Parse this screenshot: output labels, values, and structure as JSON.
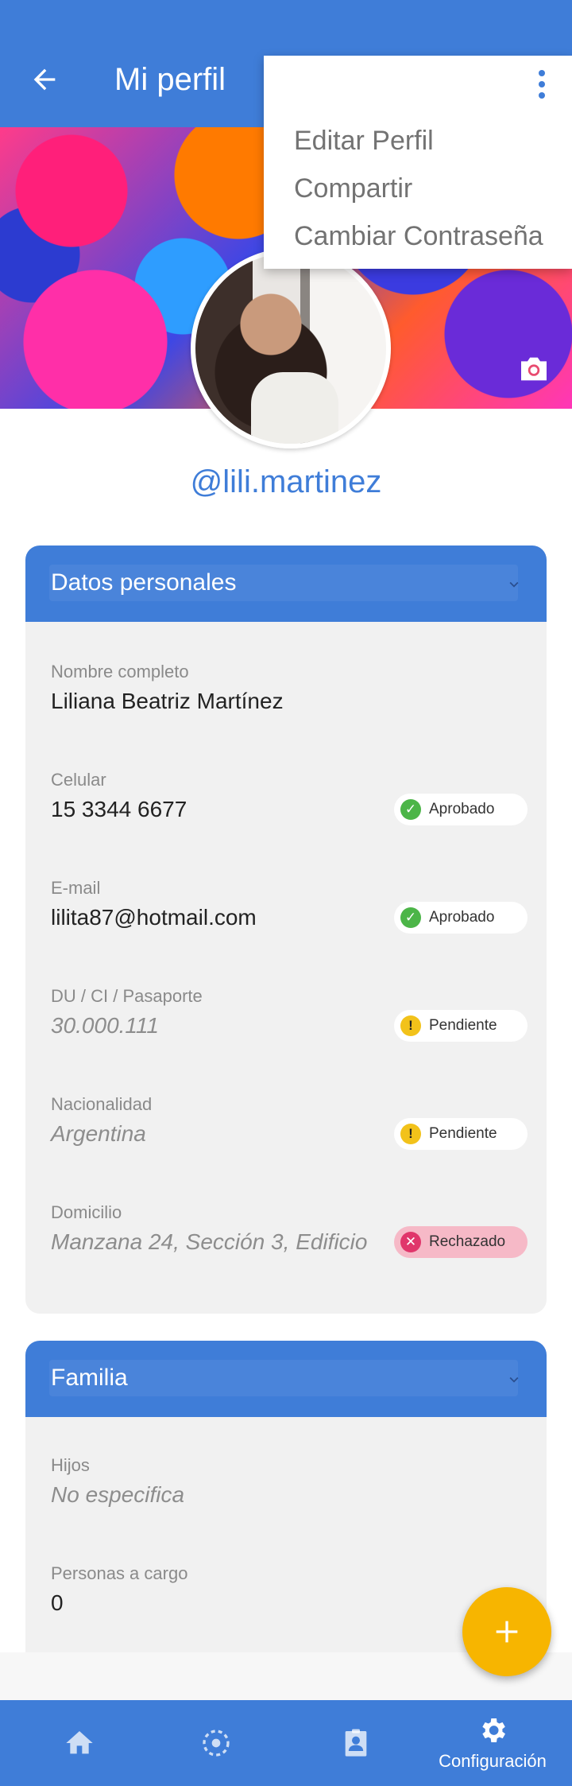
{
  "app_bar": {
    "title": "Mi perfil"
  },
  "menu": {
    "items": [
      "Editar Perfil",
      "Compartir",
      "Cambiar Contraseña"
    ]
  },
  "profile": {
    "username": "@lili.martinez"
  },
  "personal": {
    "title": "Datos personales",
    "fields": [
      {
        "label": "Nombre completo",
        "value": "Liliana Beatriz Martínez"
      },
      {
        "label": "Celular",
        "value": "15 3344 6677",
        "status": "Aprobado"
      },
      {
        "label": "E-mail",
        "value": "lilita87@hotmail.com",
        "status": "Aprobado"
      },
      {
        "label": "DU / CI / Pasaporte",
        "value": "30.000.111",
        "status": "Pendiente"
      },
      {
        "label": "Nacionalidad",
        "value": "Argentina",
        "status": "Pendiente"
      },
      {
        "label": "Domicilio",
        "value": "Manzana 24, Sección 3, Edificio",
        "status": "Rechazado"
      }
    ]
  },
  "family": {
    "title": "Familia",
    "fields": [
      {
        "label": "Hijos",
        "value": "No especifica"
      },
      {
        "label": "Personas a cargo",
        "value": "0"
      }
    ]
  },
  "colors": {
    "primary": "#3f7dd8",
    "fab": "#f7b500",
    "approved": "#4cb548",
    "pending": "#f2c21a",
    "rejected": "#e0366b"
  },
  "bottom_nav": {
    "items": [
      {
        "icon": "home-icon"
      },
      {
        "icon": "target-icon"
      },
      {
        "icon": "contact-icon"
      },
      {
        "icon": "gear-icon",
        "label": "Configuración"
      }
    ]
  }
}
